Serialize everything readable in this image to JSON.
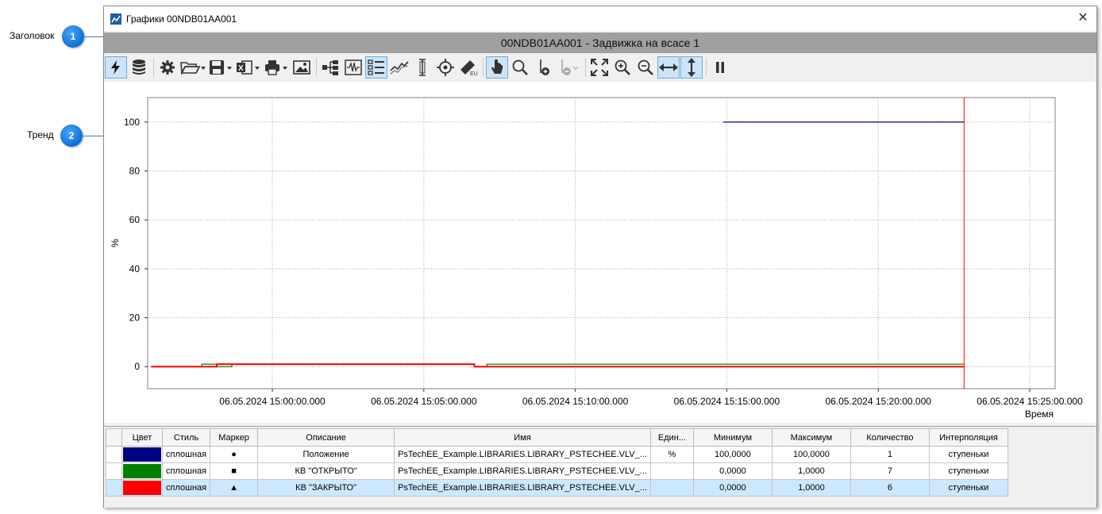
{
  "callouts": [
    {
      "num": "1",
      "label": "Заголовок"
    },
    {
      "num": "2",
      "label": "Тренд"
    }
  ],
  "window": {
    "title": "Графики 00NDB01AA001",
    "close_glyph": "✕"
  },
  "header": {
    "title": "00NDB01AA001 - Задвижка на всасе 1"
  },
  "toolbar": {
    "icons": [
      "lightning-icon",
      "database-icon",
      "gear-icon",
      "folder-open-icon",
      "save-icon",
      "excel-icon",
      "print-icon",
      "image-icon",
      "tree-icon",
      "waveform-icon",
      "list-icon",
      "trend-icon",
      "cursor-bar-icon",
      "target-icon",
      "ruler-icon",
      "pointer-icon",
      "zoom-icon",
      "add-marker-icon",
      "remove-marker-icon",
      "fit-icon",
      "zoom-in-icon",
      "zoom-out-icon",
      "horizontal-icon",
      "vertical-icon",
      "pause-icon"
    ]
  },
  "chart_data": {
    "type": "line",
    "ylabel": "%",
    "xlabel": "Время",
    "ylim": [
      -9,
      110
    ],
    "yticks": [
      "0",
      "20",
      "40",
      "60",
      "80",
      "100"
    ],
    "xticks": [
      "06.05.2024 15:00:00.000",
      "06.05.2024 15:05:00.000",
      "06.05.2024 15:10:00.000",
      "06.05.2024 15:15:00.000",
      "06.05.2024 15:20:00.000",
      "06.05.2024 15:25:00.000"
    ],
    "grid": true,
    "cursor_time": "06.05.2024 15:22:50.000",
    "series": [
      {
        "name": "Положение",
        "color": "#000080",
        "interpolation": "step",
        "points": [
          [
            "06.05.2024 15:14:53",
            100
          ],
          [
            "06.05.2024 15:22:50",
            100
          ]
        ]
      },
      {
        "name": "КВ \"ОТКРЫТО\"",
        "color": "#008000",
        "interpolation": "step",
        "points": [
          [
            "06.05.2024 14:56:00",
            0
          ],
          [
            "06.05.2024 14:57:40",
            1
          ],
          [
            "06.05.2024 14:58:10",
            0
          ],
          [
            "06.05.2024 14:58:40",
            1
          ],
          [
            "06.05.2024 15:06:40",
            1
          ],
          [
            "06.05.2024 15:06:40",
            0
          ],
          [
            "06.05.2024 15:07:05",
            0
          ],
          [
            "06.05.2024 15:07:05",
            1
          ],
          [
            "06.05.2024 15:22:50",
            1
          ]
        ]
      },
      {
        "name": "КВ \"ЗАКРЫТО\"",
        "color": "#ff0000",
        "interpolation": "step",
        "points": [
          [
            "06.05.2024 14:56:00",
            0
          ],
          [
            "06.05.2024 14:58:10",
            0
          ],
          [
            "06.05.2024 14:58:10",
            1
          ],
          [
            "06.05.2024 15:06:40",
            1
          ],
          [
            "06.05.2024 15:06:40",
            0
          ],
          [
            "06.05.2024 15:22:50",
            0
          ]
        ]
      }
    ]
  },
  "table": {
    "headers": [
      "",
      "Цвет",
      "Стиль",
      "Маркер",
      "Описание",
      "Имя",
      "Един...",
      "Минимум",
      "Максимум",
      "Количество",
      "Интерполяция"
    ],
    "rows": [
      {
        "color": "#000080",
        "style": "сплошная",
        "marker": "●",
        "description": "Положение",
        "name": "PsTechEE_Example.LIBRARIES.LIBRARY_PSTECHEE.VLV_...",
        "unit": "%",
        "min": "100,0000",
        "max": "100,0000",
        "count": "1",
        "interp": "ступеньки"
      },
      {
        "color": "#008000",
        "style": "сплошная",
        "marker": "■",
        "description": "КВ \"ОТКРЫТО\"",
        "name": "PsTechEE_Example.LIBRARIES.LIBRARY_PSTECHEE.VLV_...",
        "unit": "",
        "min": "0,0000",
        "max": "1,0000",
        "count": "7",
        "interp": "ступеньки"
      },
      {
        "color": "#ff0000",
        "style": "сплошная",
        "marker": "▲",
        "description": "КВ \"ЗАКРЫТО\"",
        "name": "PsTechEE_Example.LIBRARIES.LIBRARY_PSTECHEE.VLV_...",
        "unit": "",
        "min": "0,0000",
        "max": "1,0000",
        "count": "6",
        "interp": "ступеньки"
      }
    ]
  }
}
